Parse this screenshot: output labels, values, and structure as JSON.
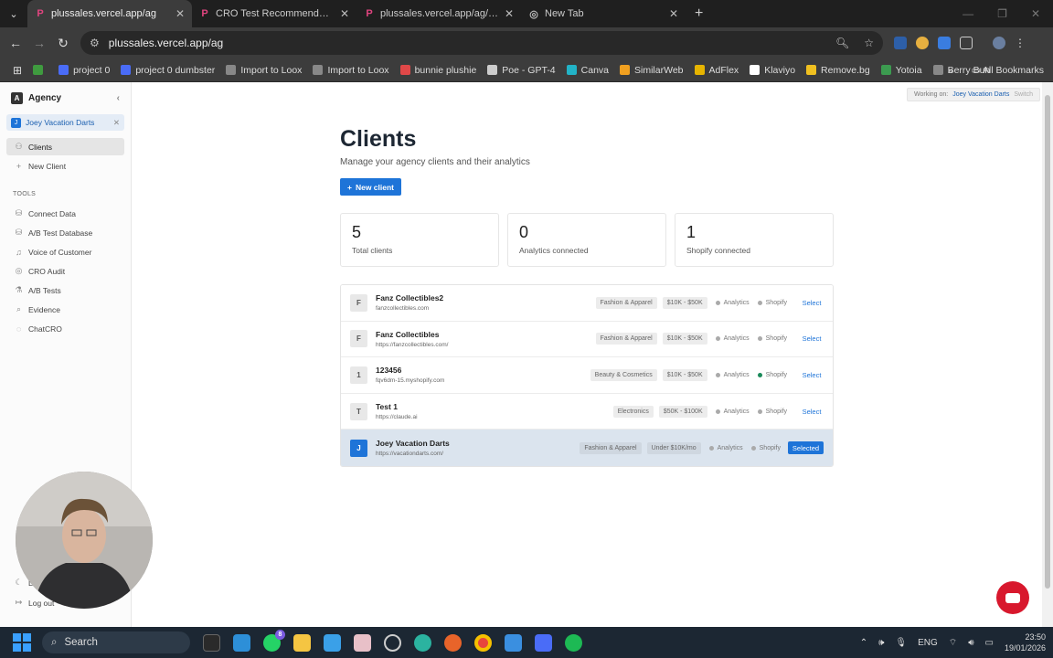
{
  "browser": {
    "tabs": [
      {
        "title": "plussales.vercel.app/ag",
        "active": true,
        "icon": "p-icon"
      },
      {
        "title": "CRO Test Recommendations • P",
        "active": false,
        "icon": "p-icon"
      },
      {
        "title": "plussales.vercel.app/ag/cro-inte",
        "active": false,
        "icon": "p-icon"
      },
      {
        "title": "New Tab",
        "active": false,
        "icon": "chrome-icon"
      }
    ],
    "url": "plussales.vercel.app/ag",
    "bookmarks": [
      {
        "label": "",
        "color": "#3f9b3f"
      },
      {
        "label": "project 0",
        "color": "#4a6cf7"
      },
      {
        "label": "project 0 dumbster",
        "color": "#4a6cf7"
      },
      {
        "label": "Import to Loox",
        "color": "#888"
      },
      {
        "label": "Import to Loox",
        "color": "#888"
      },
      {
        "label": "bunnie plushie",
        "color": "#e04848"
      },
      {
        "label": "Poe - GPT-4",
        "color": "#ccc"
      },
      {
        "label": "Canva",
        "color": "#22b3c7"
      },
      {
        "label": "SimilarWeb",
        "color": "#f0a020"
      },
      {
        "label": "AdFlex",
        "color": "#e6b400"
      },
      {
        "label": "Klaviyo",
        "color": "#fff"
      },
      {
        "label": "Remove.bg",
        "color": "#f0c020"
      },
      {
        "label": "Yotoia",
        "color": "#3c9b50"
      },
      {
        "label": "Berry Bun",
        "color": "#888"
      }
    ],
    "all_bookmarks": "All Bookmarks"
  },
  "sidebar": {
    "org_initial": "A",
    "org_name": "Agency",
    "workspace_initial": "J",
    "workspace_name": "Joey Vacation Darts",
    "items": [
      {
        "label": "Clients",
        "active": true
      },
      {
        "label": "New Client",
        "active": false
      }
    ],
    "tools_heading": "TOOLS",
    "tools": [
      {
        "label": "Connect Data"
      },
      {
        "label": "A/B Test Database"
      },
      {
        "label": "Voice of Customer"
      },
      {
        "label": "CRO Audit"
      },
      {
        "label": "A/B Tests"
      },
      {
        "label": "Evidence"
      },
      {
        "label": "ChatCRO"
      }
    ],
    "bottom": [
      {
        "label": "Da"
      },
      {
        "label": "Log out"
      }
    ]
  },
  "working_on": {
    "prefix": "Working on:",
    "client": "Joey Vacation Darts",
    "switch": "Switch"
  },
  "main": {
    "title": "Clients",
    "subtitle": "Manage your agency clients and their analytics",
    "new_client": "New client",
    "stats": [
      {
        "value": "5",
        "label": "Total clients"
      },
      {
        "value": "0",
        "label": "Analytics connected"
      },
      {
        "value": "1",
        "label": "Shopify connected"
      }
    ],
    "clients": [
      {
        "initial": "F",
        "name": "Fanz Collectibles2",
        "url": "fanzcollectibles.com",
        "category": "Fashion & Apparel",
        "revenue": "$10K - $50K",
        "analytics": "Analytics",
        "shopify": "Shopify",
        "shopify_on": false,
        "action": "Select",
        "selected": false
      },
      {
        "initial": "F",
        "name": "Fanz Collectibles",
        "url": "https://fanzcollectibles.com/",
        "category": "Fashion & Apparel",
        "revenue": "$10K - $50K",
        "analytics": "Analytics",
        "shopify": "Shopify",
        "shopify_on": false,
        "action": "Select",
        "selected": false
      },
      {
        "initial": "1",
        "name": "123456",
        "url": "fqv6dm-15.myshopify.com",
        "category": "Beauty & Cosmetics",
        "revenue": "$10K - $50K",
        "analytics": "Analytics",
        "shopify": "Shopify",
        "shopify_on": true,
        "action": "Select",
        "selected": false
      },
      {
        "initial": "T",
        "name": "Test 1",
        "url": "https://claude.ai",
        "category": "Electronics",
        "revenue": "$50K - $100K",
        "analytics": "Analytics",
        "shopify": "Shopify",
        "shopify_on": false,
        "action": "Select",
        "selected": false
      },
      {
        "initial": "J",
        "name": "Joey Vacation Darts",
        "url": "https://vacationdarts.com/",
        "category": "Fashion & Apparel",
        "revenue": "Under $10K/mo",
        "analytics": "Analytics",
        "shopify": "Shopify",
        "shopify_on": false,
        "action": "Selected",
        "selected": true
      }
    ]
  },
  "taskbar": {
    "search": "Search",
    "lang": "ENG",
    "time": "23:50",
    "date": "19/01/2026",
    "whatsapp_badge": "8"
  }
}
